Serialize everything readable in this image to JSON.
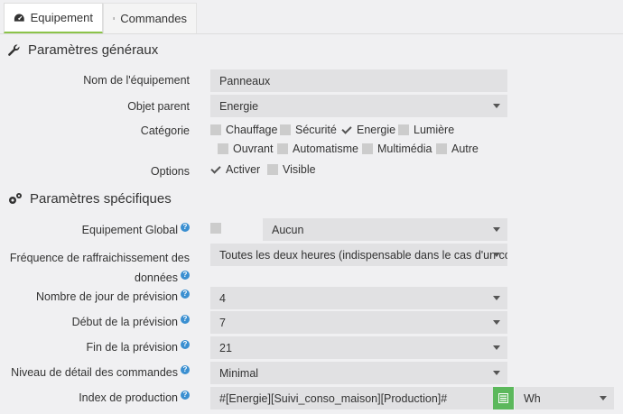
{
  "tabs": {
    "equipement": "Equipement",
    "commandes": "Commandes"
  },
  "sections": {
    "general": "Paramètres généraux",
    "specific": "Paramètres spécifiques"
  },
  "general": {
    "name_label": "Nom de l'équipement",
    "name_value": "Panneaux",
    "parent_label": "Objet parent",
    "parent_value": "Energie",
    "category_label": "Catégorie",
    "categories": [
      {
        "label": "Chauffage",
        "checked": false
      },
      {
        "label": "Sécurité",
        "checked": false
      },
      {
        "label": "Energie",
        "checked": true
      },
      {
        "label": "Lumière",
        "checked": false
      },
      {
        "label": "Ouvrant",
        "checked": false
      },
      {
        "label": "Automatisme",
        "checked": false
      },
      {
        "label": "Multimédia",
        "checked": false
      },
      {
        "label": "Autre",
        "checked": false
      }
    ],
    "options_label": "Options",
    "options": [
      {
        "label": "Activer",
        "checked": true
      },
      {
        "label": "Visible",
        "checked": false
      }
    ]
  },
  "specific": {
    "global_label": "Equipement Global",
    "global_value": "Aucun",
    "freq_label_1": "Fréquence de raffraichissement des",
    "freq_label_2": "données",
    "freq_value": "Toutes les deux heures (indispensable dans le cas d'un con",
    "days_label": "Nombre de jour de prévision",
    "days_value": "4",
    "start_label": "Début de la prévision",
    "start_value": "7",
    "end_label": "Fin de la prévision",
    "end_value": "21",
    "detail_label": "Niveau de détail des commandes",
    "detail_value": "Minimal",
    "index_label": "Index de production",
    "index_value": "#[Energie][Suivi_conso_maison][Production]#",
    "unit_value": "Wh"
  },
  "help_glyph": "?",
  "colors": {
    "accent_green": "#8bc34a",
    "button_green": "#5cb85c",
    "help_blue": "#3a8fd1",
    "field_bg": "#e1e1e3"
  }
}
